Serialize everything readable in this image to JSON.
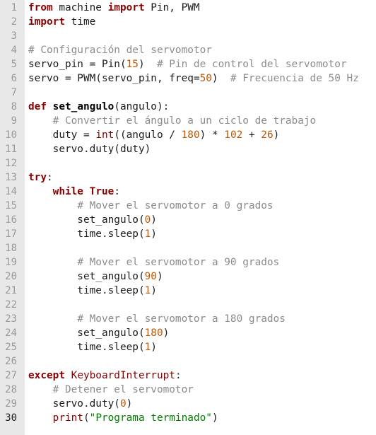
{
  "editor": {
    "active_line": 30,
    "lines": [
      [
        {
          "t": "kw",
          "v": "from"
        },
        {
          "t": "p",
          "v": " machine "
        },
        {
          "t": "kw",
          "v": "import"
        },
        {
          "t": "p",
          "v": " Pin, PWM"
        }
      ],
      [
        {
          "t": "kw",
          "v": "import"
        },
        {
          "t": "p",
          "v": " time"
        }
      ],
      [],
      [
        {
          "t": "cmt",
          "v": "# Configuración del servomotor"
        }
      ],
      [
        {
          "t": "p",
          "v": "servo_pin = Pin("
        },
        {
          "t": "num",
          "v": "15"
        },
        {
          "t": "p",
          "v": ")  "
        },
        {
          "t": "cmt",
          "v": "# Pin de control del servomotor"
        }
      ],
      [
        {
          "t": "p",
          "v": "servo = PWM(servo_pin, freq="
        },
        {
          "t": "num",
          "v": "50"
        },
        {
          "t": "p",
          "v": ")  "
        },
        {
          "t": "cmt",
          "v": "# Frecuencia de 50 Hz"
        }
      ],
      [],
      [
        {
          "t": "kw",
          "v": "def"
        },
        {
          "t": "p",
          "v": " "
        },
        {
          "t": "fn",
          "v": "set_angulo"
        },
        {
          "t": "p",
          "v": "(angulo):"
        }
      ],
      [
        {
          "t": "p",
          "v": "    "
        },
        {
          "t": "cmt",
          "v": "# Convertir el ángulo a un ciclo de trabajo"
        }
      ],
      [
        {
          "t": "p",
          "v": "    duty = "
        },
        {
          "t": "bi",
          "v": "int"
        },
        {
          "t": "p",
          "v": "((angulo / "
        },
        {
          "t": "num",
          "v": "180"
        },
        {
          "t": "p",
          "v": ") * "
        },
        {
          "t": "num",
          "v": "102"
        },
        {
          "t": "p",
          "v": " + "
        },
        {
          "t": "num",
          "v": "26"
        },
        {
          "t": "p",
          "v": ")"
        }
      ],
      [
        {
          "t": "p",
          "v": "    servo.duty(duty)"
        }
      ],
      [],
      [
        {
          "t": "kw",
          "v": "try"
        },
        {
          "t": "p",
          "v": ":"
        }
      ],
      [
        {
          "t": "p",
          "v": "    "
        },
        {
          "t": "kw",
          "v": "while"
        },
        {
          "t": "p",
          "v": " "
        },
        {
          "t": "kw",
          "v": "True"
        },
        {
          "t": "p",
          "v": ":"
        }
      ],
      [
        {
          "t": "p",
          "v": "        "
        },
        {
          "t": "cmt",
          "v": "# Mover el servomotor a 0 grados"
        }
      ],
      [
        {
          "t": "p",
          "v": "        set_angulo("
        },
        {
          "t": "num",
          "v": "0"
        },
        {
          "t": "p",
          "v": ")"
        }
      ],
      [
        {
          "t": "p",
          "v": "        time.sleep("
        },
        {
          "t": "num",
          "v": "1"
        },
        {
          "t": "p",
          "v": ")"
        }
      ],
      [],
      [
        {
          "t": "p",
          "v": "        "
        },
        {
          "t": "cmt",
          "v": "# Mover el servomotor a 90 grados"
        }
      ],
      [
        {
          "t": "p",
          "v": "        set_angulo("
        },
        {
          "t": "num",
          "v": "90"
        },
        {
          "t": "p",
          "v": ")"
        }
      ],
      [
        {
          "t": "p",
          "v": "        time.sleep("
        },
        {
          "t": "num",
          "v": "1"
        },
        {
          "t": "p",
          "v": ")"
        }
      ],
      [],
      [
        {
          "t": "p",
          "v": "        "
        },
        {
          "t": "cmt",
          "v": "# Mover el servomotor a 180 grados"
        }
      ],
      [
        {
          "t": "p",
          "v": "        set_angulo("
        },
        {
          "t": "num",
          "v": "180"
        },
        {
          "t": "p",
          "v": ")"
        }
      ],
      [
        {
          "t": "p",
          "v": "        time.sleep("
        },
        {
          "t": "num",
          "v": "1"
        },
        {
          "t": "p",
          "v": ")"
        }
      ],
      [],
      [
        {
          "t": "kw",
          "v": "except"
        },
        {
          "t": "p",
          "v": " "
        },
        {
          "t": "err",
          "v": "KeyboardInterrupt"
        },
        {
          "t": "p",
          "v": ":"
        }
      ],
      [
        {
          "t": "p",
          "v": "    "
        },
        {
          "t": "cmt",
          "v": "# Detener el servomotor"
        }
      ],
      [
        {
          "t": "p",
          "v": "    servo.duty("
        },
        {
          "t": "num",
          "v": "0"
        },
        {
          "t": "p",
          "v": ")"
        }
      ],
      [
        {
          "t": "p",
          "v": "    "
        },
        {
          "t": "bi",
          "v": "print"
        },
        {
          "t": "p",
          "v": "("
        },
        {
          "t": "str",
          "v": "\"Programa terminado\""
        },
        {
          "t": "p",
          "v": ")"
        }
      ]
    ]
  },
  "colors": {
    "keyword": "#8a0000",
    "comment": "#8c8c8c",
    "number": "#c05800",
    "string": "#008000",
    "gutter_bg": "#e8e8e8",
    "line_number": "#999999"
  }
}
